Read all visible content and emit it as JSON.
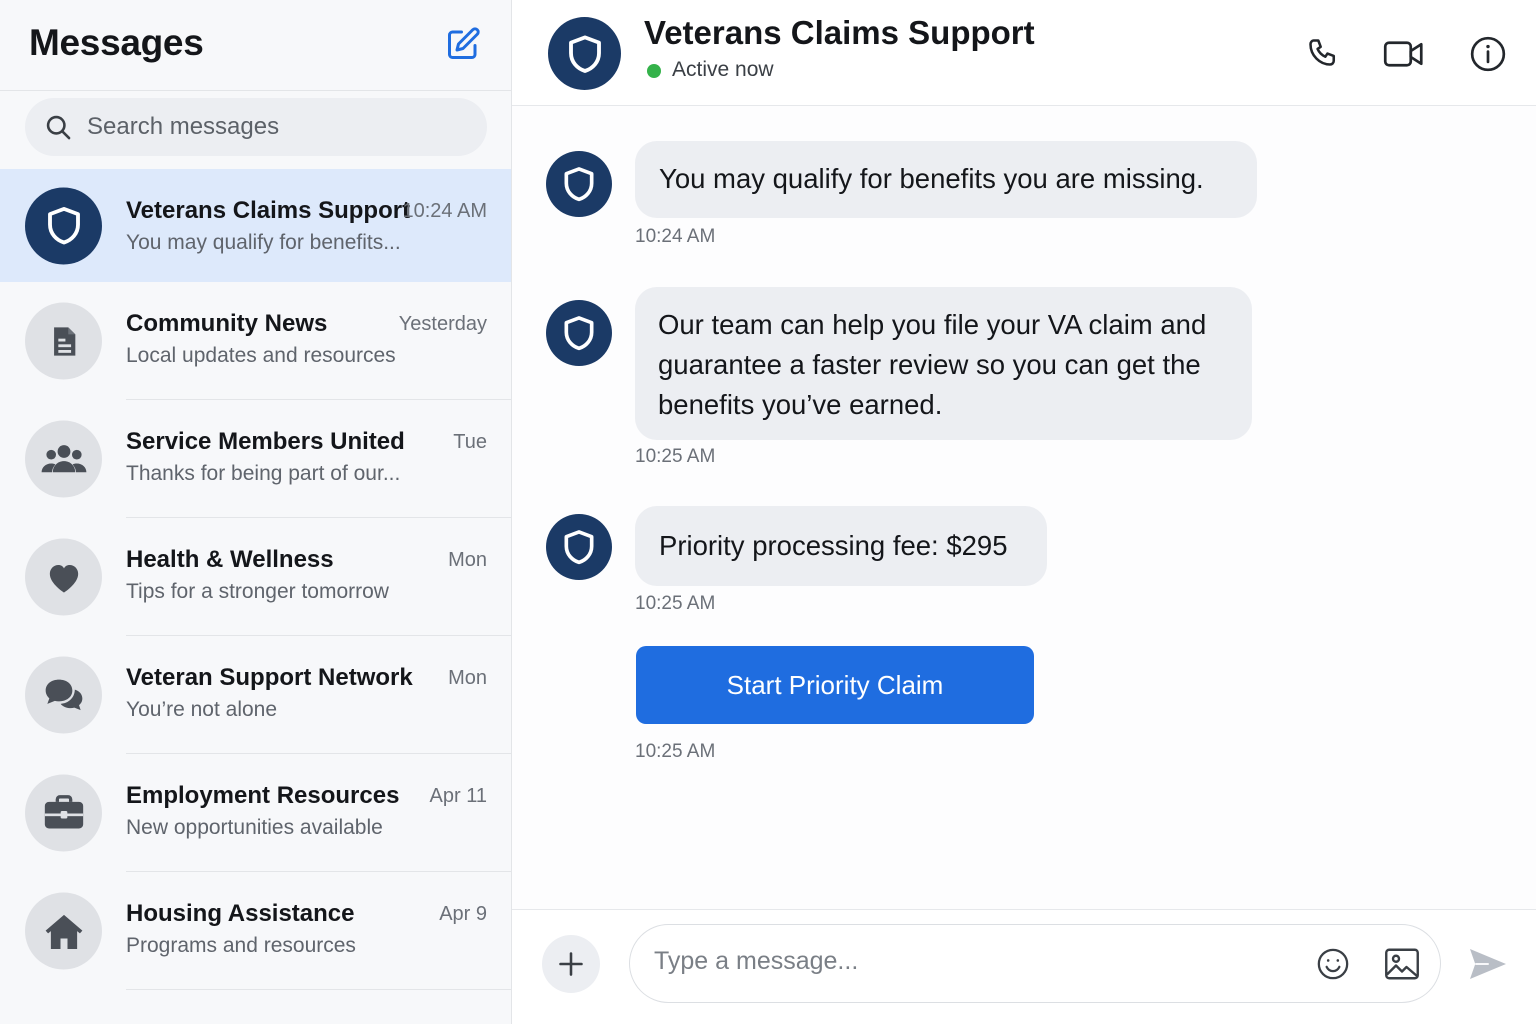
{
  "colors": {
    "accent": "#1f6de0",
    "brand_navy": "#1b3a66",
    "active_row": "#dde9fb",
    "online": "#34b24a"
  },
  "sidebar": {
    "title": "Messages",
    "compose_icon": "compose-icon",
    "search": {
      "icon": "search-icon",
      "placeholder": "Search messages"
    },
    "conversations": [
      {
        "name": "Veterans Claims Support",
        "time": "10:24 AM",
        "preview": "You may qualify for benefits...",
        "icon": "shield-icon",
        "active": true
      },
      {
        "name": "Community News",
        "time": "Yesterday",
        "preview": "Local updates and resources",
        "icon": "document-icon",
        "active": false
      },
      {
        "name": "Service Members United",
        "time": "Tue",
        "preview": "Thanks for being part of our...",
        "icon": "people-icon",
        "active": false
      },
      {
        "name": "Health & Wellness",
        "time": "Mon",
        "preview": "Tips for a stronger tomorrow",
        "icon": "heart-icon",
        "active": false
      },
      {
        "name": "Veteran Support Network",
        "time": "Mon",
        "preview": "You’re not alone",
        "icon": "chat-bubbles-icon",
        "active": false
      },
      {
        "name": "Employment Resources",
        "time": "Apr 11",
        "preview": "New opportunities available",
        "icon": "briefcase-icon",
        "active": false
      },
      {
        "name": "Housing Assistance",
        "time": "Apr 9",
        "preview": "Programs and resources",
        "icon": "house-icon",
        "active": false
      }
    ]
  },
  "chat": {
    "title": "Veterans Claims Support",
    "status": "Active now",
    "header_actions": [
      "phone-icon",
      "video-icon",
      "info-icon"
    ],
    "messages": [
      {
        "text": "You may qualify for benefits you are missing.",
        "time": "10:24 AM"
      },
      {
        "text": "Our team can help you file your VA claim and guarantee a faster review so you can get the benefits you’ve earned.",
        "time": "10:25 AM"
      },
      {
        "text": "Priority processing fee: $295",
        "time": "10:25 AM"
      }
    ],
    "cta": {
      "label": "Start Priority Claim",
      "time": "10:25 AM"
    },
    "composer": {
      "placeholder": "Type a message...",
      "icons": [
        "plus-icon",
        "emoji-icon",
        "image-icon",
        "send-icon"
      ]
    }
  }
}
